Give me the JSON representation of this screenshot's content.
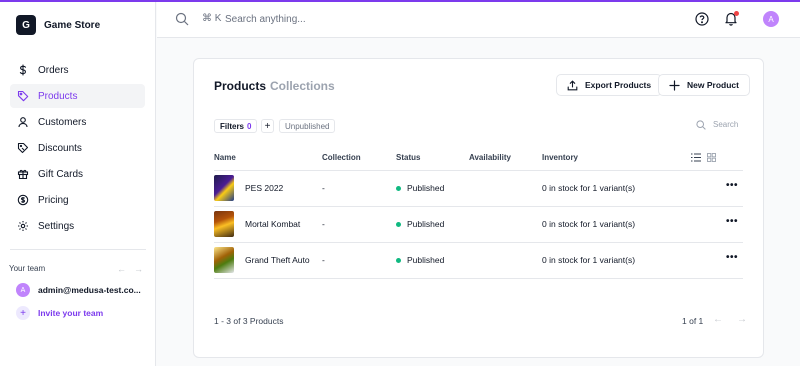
{
  "app": {
    "logo_letter": "G",
    "store_name": "Game Store"
  },
  "colors": {
    "accent": "#7c3aed",
    "published": "#10b981"
  },
  "sidebar": {
    "items": [
      {
        "label": "Orders",
        "icon": "dollar-icon",
        "active": false
      },
      {
        "label": "Products",
        "icon": "tag-icon",
        "active": true
      },
      {
        "label": "Customers",
        "icon": "user-icon",
        "active": false
      },
      {
        "label": "Discounts",
        "icon": "discount-icon",
        "active": false
      },
      {
        "label": "Gift Cards",
        "icon": "gift-icon",
        "active": false
      },
      {
        "label": "Pricing",
        "icon": "coin-icon",
        "active": false
      },
      {
        "label": "Settings",
        "icon": "gear-icon",
        "active": false
      }
    ],
    "team": {
      "title": "Your team",
      "prev_arrow": "←",
      "next_arrow": "→",
      "member_initial": "A",
      "member_email": "admin@medusa-test.co...",
      "invite_label": "Invite your team"
    }
  },
  "topbar": {
    "shortcut": "⌘ K",
    "search_placeholder": "Search anything...",
    "user_initial": "A"
  },
  "products": {
    "tabs": [
      "Products",
      "Collections"
    ],
    "export_label": "Export Products",
    "new_label": "New Product",
    "filters_label": "Filters",
    "filters_count": "0",
    "add_filter": "+",
    "unpublished_chip": "Unpublished",
    "search_label": "Search",
    "columns": [
      "Name",
      "Collection",
      "Status",
      "Availability",
      "Inventory"
    ],
    "rows": [
      {
        "name": "PES 2022",
        "collection": "-",
        "status": "Published",
        "availability": "",
        "inventory": "0 in stock for 1 variant(s)"
      },
      {
        "name": "Mortal Kombat",
        "collection": "-",
        "status": "Published",
        "availability": "",
        "inventory": "0 in stock for 1 variant(s)"
      },
      {
        "name": "Grand Theft Auto",
        "collection": "-",
        "status": "Published",
        "availability": "",
        "inventory": "0 in stock for 1 variant(s)"
      }
    ],
    "pagination": {
      "summary": "1 - 3 of 3 Products",
      "page": "1 of 1",
      "prev": "←",
      "next": "→"
    }
  }
}
